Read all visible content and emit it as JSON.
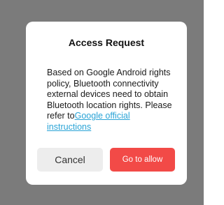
{
  "dialog": {
    "title": "Access Request",
    "message": "Based on Google Android rights policy, Bluetooth connectivity external devices need to obtain Bluetooth location rights.  Please refer to",
    "link_text": "Google official instructions",
    "cancel_label": "Cancel",
    "allow_label": "Go to allow"
  },
  "colors": {
    "backdrop": "#7b7b7b",
    "dialog_bg": "#ffffff",
    "link": "#29a3d6",
    "allow_button": "#f24a47",
    "cancel_button": "#ededed"
  }
}
